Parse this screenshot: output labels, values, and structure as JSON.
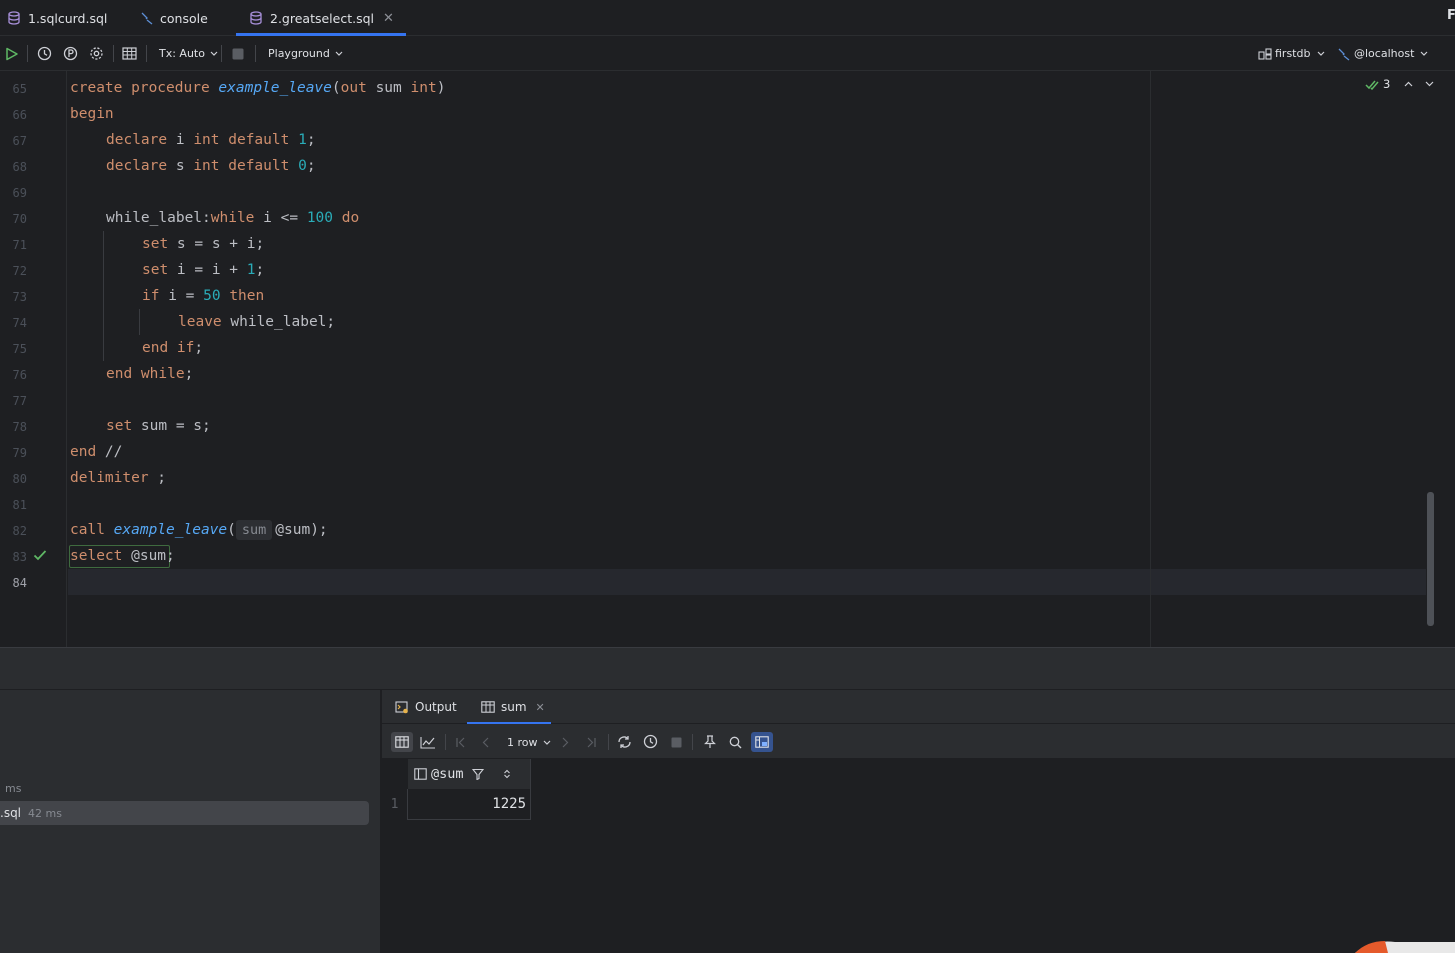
{
  "tabs": [
    {
      "label": "1.sqlcurd.sql",
      "icon": "database-file-icon"
    },
    {
      "label": "console",
      "icon": "console-icon"
    },
    {
      "label": "2.greatselect.sql",
      "icon": "database-file-icon",
      "active": true
    }
  ],
  "corner_letter": "F",
  "toolbar": {
    "tx_label": "Tx: Auto",
    "playground_label": "Playground",
    "schema_label": "firstdb",
    "datasource_label": "@localhost"
  },
  "inspections": {
    "count": "3"
  },
  "editor": {
    "current_line": "84",
    "lines": [
      {
        "n": "65"
      },
      {
        "n": "66"
      },
      {
        "n": "67"
      },
      {
        "n": "68"
      },
      {
        "n": "69"
      },
      {
        "n": "70"
      },
      {
        "n": "71"
      },
      {
        "n": "72"
      },
      {
        "n": "73"
      },
      {
        "n": "74"
      },
      {
        "n": "75"
      },
      {
        "n": "76"
      },
      {
        "n": "77"
      },
      {
        "n": "78"
      },
      {
        "n": "79"
      },
      {
        "n": "80"
      },
      {
        "n": "81"
      },
      {
        "n": "82"
      },
      {
        "n": "83"
      },
      {
        "n": "84"
      }
    ],
    "code": {
      "l65": {
        "kw1": "create procedure ",
        "fn": "example_leave",
        "p1": "(",
        "kw2": "out",
        "rest": " sum ",
        "kw3": "int",
        "end": ")"
      },
      "l66": {
        "kw": "begin"
      },
      "l67": {
        "kw1": "declare",
        "id": " i ",
        "kw2": "int default",
        "sp": " ",
        "num": "1",
        "end": ";"
      },
      "l68": {
        "kw1": "declare",
        "id": " s ",
        "kw2": "int default",
        "sp": " ",
        "num": "0",
        "end": ";"
      },
      "l70": {
        "id1": "while_label:",
        "kw1": "while",
        "id2": " i <= ",
        "num": "100",
        "sp": " ",
        "kw2": "do"
      },
      "l71": {
        "kw": "set",
        "rest": " s = s + i;"
      },
      "l72": {
        "kw": "set",
        "rest": " i = i + ",
        "num": "1",
        "end": ";"
      },
      "l73": {
        "kw1": "if",
        "id": " i = ",
        "num": "50",
        "sp": " ",
        "kw2": "then"
      },
      "l74": {
        "kw": "leave",
        "rest": " while_label;"
      },
      "l75": {
        "kw": "end if",
        "end": ";"
      },
      "l76": {
        "kw": "end while",
        "end": ";"
      },
      "l78": {
        "kw": "set",
        "rest": " sum = s;"
      },
      "l79": {
        "kw": "end",
        "rest": " //"
      },
      "l80": {
        "kw": "delimiter",
        "rest": " ;"
      },
      "l82": {
        "kw": "call",
        "sp": " ",
        "fn": "example_leave",
        "p1": "(",
        "hint": "sum",
        "rest": "@sum);"
      },
      "l83": {
        "kw": "select",
        "rest": " @sum;"
      }
    }
  },
  "services": {
    "ms_label": "ms",
    "row_name": ".sql",
    "row_time": "42 ms"
  },
  "results": {
    "tabs": [
      {
        "label": "Output"
      },
      {
        "label": "sum"
      }
    ],
    "row_count": "1 row",
    "column": "@sum",
    "rows": [
      {
        "num": "1",
        "value": "1225"
      }
    ]
  },
  "colors": {
    "accent": "#3574f0",
    "keyword": "#cf8e6d",
    "function": "#56a8f5",
    "number": "#2aacb8",
    "success": "#5fb865"
  }
}
